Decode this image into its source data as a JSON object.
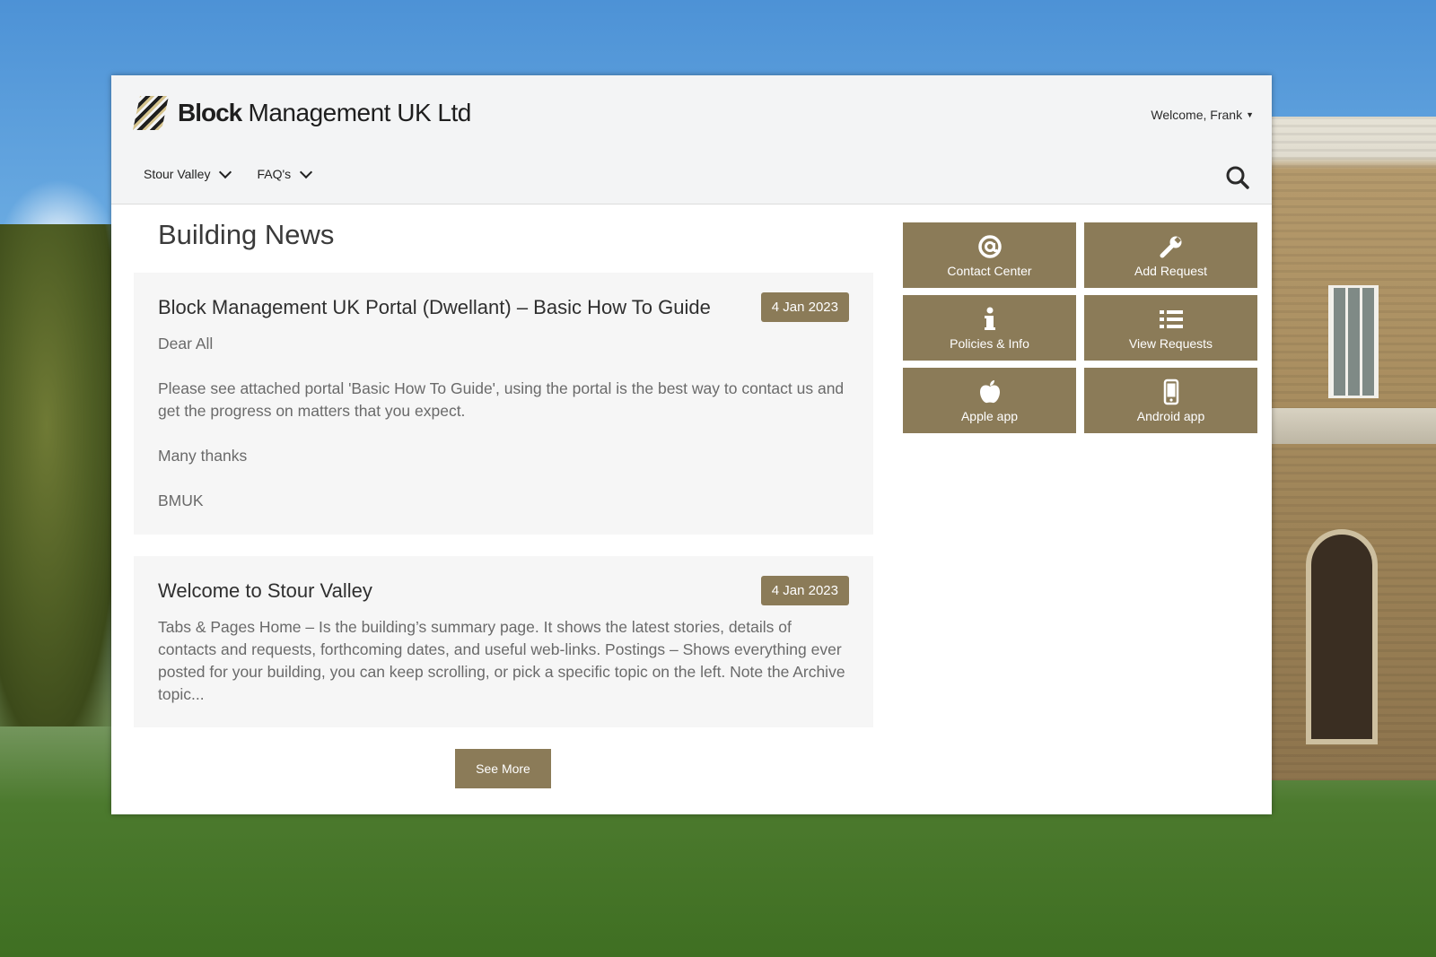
{
  "brand": {
    "name_bold": "Block",
    "name_rest": " Management UK Ltd"
  },
  "user": {
    "welcome": "Welcome, Frank"
  },
  "nav": {
    "items": [
      {
        "label": "Stour Valley"
      },
      {
        "label": "FAQ's"
      }
    ]
  },
  "news": {
    "heading": "Building News",
    "posts": [
      {
        "title": "Block Management UK Portal (Dwellant) – Basic How To Guide",
        "date": "4 Jan 2023",
        "paragraphs": [
          "Dear All",
          "Please see attached portal 'Basic How To Guide', using the portal is the best way to contact us and get the progress on matters that you expect.",
          "Many thanks",
          "BMUK"
        ]
      },
      {
        "title": "Welcome to Stour Valley",
        "date": "4 Jan 2023",
        "paragraphs": [
          "Tabs & Pages Home – Is the building’s summary page. It shows the latest stories, details of contacts and requests, forthcoming dates, and useful web-links. Postings – Shows everything ever posted for your building, you can keep scrolling, or pick a specific topic on the left. Note the Archive topic..."
        ]
      }
    ],
    "see_more": "See More"
  },
  "tiles": [
    {
      "label": "Contact Center",
      "icon": "at-icon"
    },
    {
      "label": "Add Request",
      "icon": "wrench-icon"
    },
    {
      "label": "Policies & Info",
      "icon": "info-icon"
    },
    {
      "label": "View Requests",
      "icon": "list-icon"
    },
    {
      "label": "Apple app",
      "icon": "apple-icon"
    },
    {
      "label": "Android app",
      "icon": "mobile-icon"
    }
  ],
  "colors": {
    "accent": "#8b7b58",
    "header_bg": "#f3f4f5",
    "card_bg": "#f6f6f6"
  }
}
